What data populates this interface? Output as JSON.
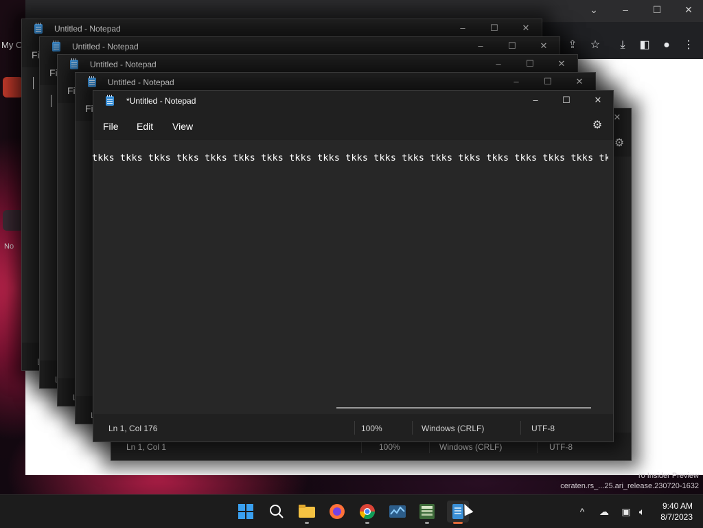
{
  "browser": {
    "left_tab_text": "My C",
    "toolbar_icons": [
      "share-icon",
      "star-icon",
      "download-icon",
      "sidebar-icon",
      "profile-icon",
      "menu-icon"
    ]
  },
  "desktop": {
    "icon_label": "No",
    "insider_line1": "ro Insider Preview",
    "insider_line2": "ceraten.rs_...25.ari_release.230720-1632"
  },
  "windows": [
    {
      "title": "Untitled - Notepad",
      "menu_peek": "Fi",
      "status_peek": "L"
    },
    {
      "title": "Untitled - Notepad",
      "menu_peek": "Fi",
      "status_peek": "L"
    },
    {
      "title": "Untitled - Notepad",
      "menu_peek": "Fi",
      "status_peek": "L"
    },
    {
      "title": "Untitled - Notepad",
      "menu_peek": "Fi",
      "status_peek": "L"
    },
    {
      "title": "Untitled - Notepad",
      "status": {
        "position": "Ln 1, Col 1",
        "zoom": "100%",
        "line_ending": "Windows (CRLF)",
        "encoding": "UTF-8"
      }
    }
  ],
  "active_window": {
    "title": "*Untitled - Notepad",
    "menu": {
      "file": "File",
      "edit": "Edit",
      "view": "View"
    },
    "text": "tkks tkks tkks tkks tkks tkks tkks tkks tkks tkks tkks tkks tkks tkks tkks tkks tkks tkks tkks",
    "status": {
      "position": "Ln 1, Col 176",
      "zoom": "100%",
      "line_ending": "Windows (CRLF)",
      "encoding": "UTF-8"
    }
  },
  "taskbar": {
    "apps": [
      "start-icon",
      "search-icon",
      "file-explorer-icon",
      "firefox-icon",
      "chrome-icon",
      "task-manager-icon",
      "app-icon",
      "notepad-icon"
    ],
    "clock": {
      "time": "9:40 AM",
      "date": "8/7/2023"
    }
  },
  "colors": {
    "notepad_bg": "#202020",
    "editor_bg": "#272727",
    "accent_indicator": "#e06a3a",
    "taskbar_bg": "#1c1c1c"
  }
}
